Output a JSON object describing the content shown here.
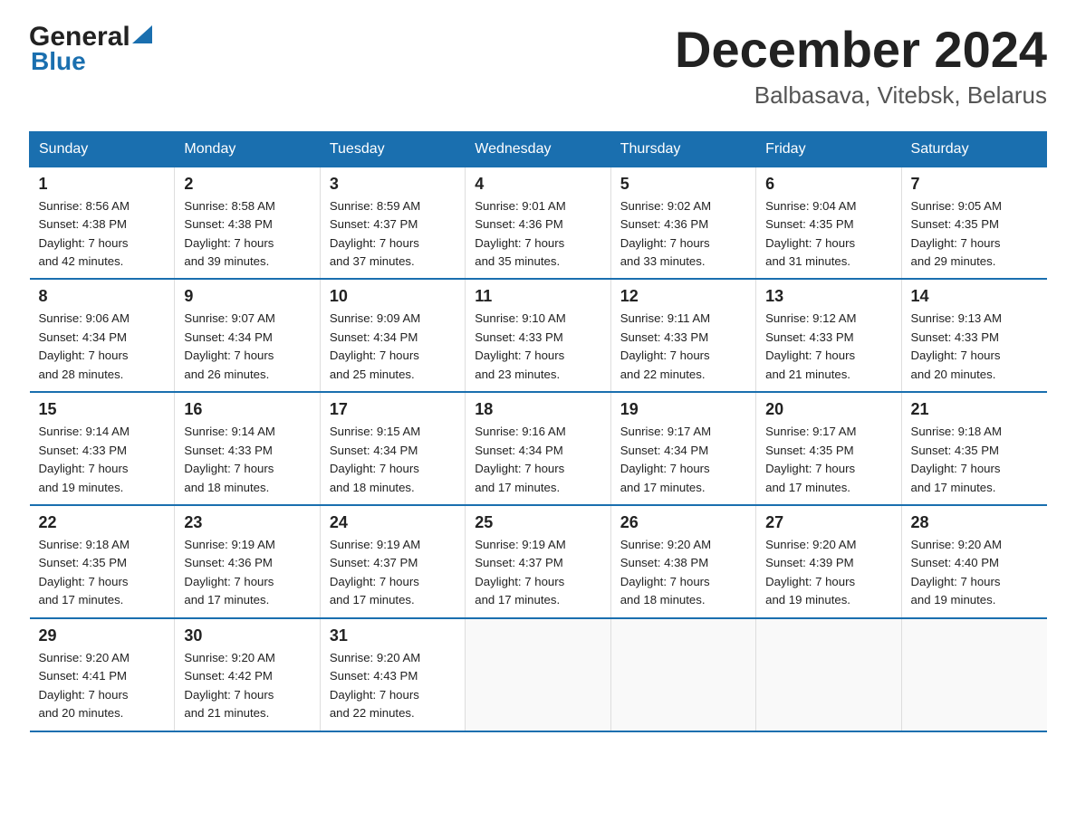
{
  "header": {
    "logo_general": "General",
    "logo_blue": "Blue",
    "month_title": "December 2024",
    "location": "Balbasava, Vitebsk, Belarus"
  },
  "days_of_week": [
    "Sunday",
    "Monday",
    "Tuesday",
    "Wednesday",
    "Thursday",
    "Friday",
    "Saturday"
  ],
  "weeks": [
    [
      {
        "day": "1",
        "sunrise": "8:56 AM",
        "sunset": "4:38 PM",
        "daylight": "7 hours and 42 minutes."
      },
      {
        "day": "2",
        "sunrise": "8:58 AM",
        "sunset": "4:38 PM",
        "daylight": "7 hours and 39 minutes."
      },
      {
        "day": "3",
        "sunrise": "8:59 AM",
        "sunset": "4:37 PM",
        "daylight": "7 hours and 37 minutes."
      },
      {
        "day": "4",
        "sunrise": "9:01 AM",
        "sunset": "4:36 PM",
        "daylight": "7 hours and 35 minutes."
      },
      {
        "day": "5",
        "sunrise": "9:02 AM",
        "sunset": "4:36 PM",
        "daylight": "7 hours and 33 minutes."
      },
      {
        "day": "6",
        "sunrise": "9:04 AM",
        "sunset": "4:35 PM",
        "daylight": "7 hours and 31 minutes."
      },
      {
        "day": "7",
        "sunrise": "9:05 AM",
        "sunset": "4:35 PM",
        "daylight": "7 hours and 29 minutes."
      }
    ],
    [
      {
        "day": "8",
        "sunrise": "9:06 AM",
        "sunset": "4:34 PM",
        "daylight": "7 hours and 28 minutes."
      },
      {
        "day": "9",
        "sunrise": "9:07 AM",
        "sunset": "4:34 PM",
        "daylight": "7 hours and 26 minutes."
      },
      {
        "day": "10",
        "sunrise": "9:09 AM",
        "sunset": "4:34 PM",
        "daylight": "7 hours and 25 minutes."
      },
      {
        "day": "11",
        "sunrise": "9:10 AM",
        "sunset": "4:33 PM",
        "daylight": "7 hours and 23 minutes."
      },
      {
        "day": "12",
        "sunrise": "9:11 AM",
        "sunset": "4:33 PM",
        "daylight": "7 hours and 22 minutes."
      },
      {
        "day": "13",
        "sunrise": "9:12 AM",
        "sunset": "4:33 PM",
        "daylight": "7 hours and 21 minutes."
      },
      {
        "day": "14",
        "sunrise": "9:13 AM",
        "sunset": "4:33 PM",
        "daylight": "7 hours and 20 minutes."
      }
    ],
    [
      {
        "day": "15",
        "sunrise": "9:14 AM",
        "sunset": "4:33 PM",
        "daylight": "7 hours and 19 minutes."
      },
      {
        "day": "16",
        "sunrise": "9:14 AM",
        "sunset": "4:33 PM",
        "daylight": "7 hours and 18 minutes."
      },
      {
        "day": "17",
        "sunrise": "9:15 AM",
        "sunset": "4:34 PM",
        "daylight": "7 hours and 18 minutes."
      },
      {
        "day": "18",
        "sunrise": "9:16 AM",
        "sunset": "4:34 PM",
        "daylight": "7 hours and 17 minutes."
      },
      {
        "day": "19",
        "sunrise": "9:17 AM",
        "sunset": "4:34 PM",
        "daylight": "7 hours and 17 minutes."
      },
      {
        "day": "20",
        "sunrise": "9:17 AM",
        "sunset": "4:35 PM",
        "daylight": "7 hours and 17 minutes."
      },
      {
        "day": "21",
        "sunrise": "9:18 AM",
        "sunset": "4:35 PM",
        "daylight": "7 hours and 17 minutes."
      }
    ],
    [
      {
        "day": "22",
        "sunrise": "9:18 AM",
        "sunset": "4:35 PM",
        "daylight": "7 hours and 17 minutes."
      },
      {
        "day": "23",
        "sunrise": "9:19 AM",
        "sunset": "4:36 PM",
        "daylight": "7 hours and 17 minutes."
      },
      {
        "day": "24",
        "sunrise": "9:19 AM",
        "sunset": "4:37 PM",
        "daylight": "7 hours and 17 minutes."
      },
      {
        "day": "25",
        "sunrise": "9:19 AM",
        "sunset": "4:37 PM",
        "daylight": "7 hours and 17 minutes."
      },
      {
        "day": "26",
        "sunrise": "9:20 AM",
        "sunset": "4:38 PM",
        "daylight": "7 hours and 18 minutes."
      },
      {
        "day": "27",
        "sunrise": "9:20 AM",
        "sunset": "4:39 PM",
        "daylight": "7 hours and 19 minutes."
      },
      {
        "day": "28",
        "sunrise": "9:20 AM",
        "sunset": "4:40 PM",
        "daylight": "7 hours and 19 minutes."
      }
    ],
    [
      {
        "day": "29",
        "sunrise": "9:20 AM",
        "sunset": "4:41 PM",
        "daylight": "7 hours and 20 minutes."
      },
      {
        "day": "30",
        "sunrise": "9:20 AM",
        "sunset": "4:42 PM",
        "daylight": "7 hours and 21 minutes."
      },
      {
        "day": "31",
        "sunrise": "9:20 AM",
        "sunset": "4:43 PM",
        "daylight": "7 hours and 22 minutes."
      },
      null,
      null,
      null,
      null
    ]
  ],
  "labels": {
    "sunrise": "Sunrise:",
    "sunset": "Sunset:",
    "daylight": "Daylight:"
  }
}
